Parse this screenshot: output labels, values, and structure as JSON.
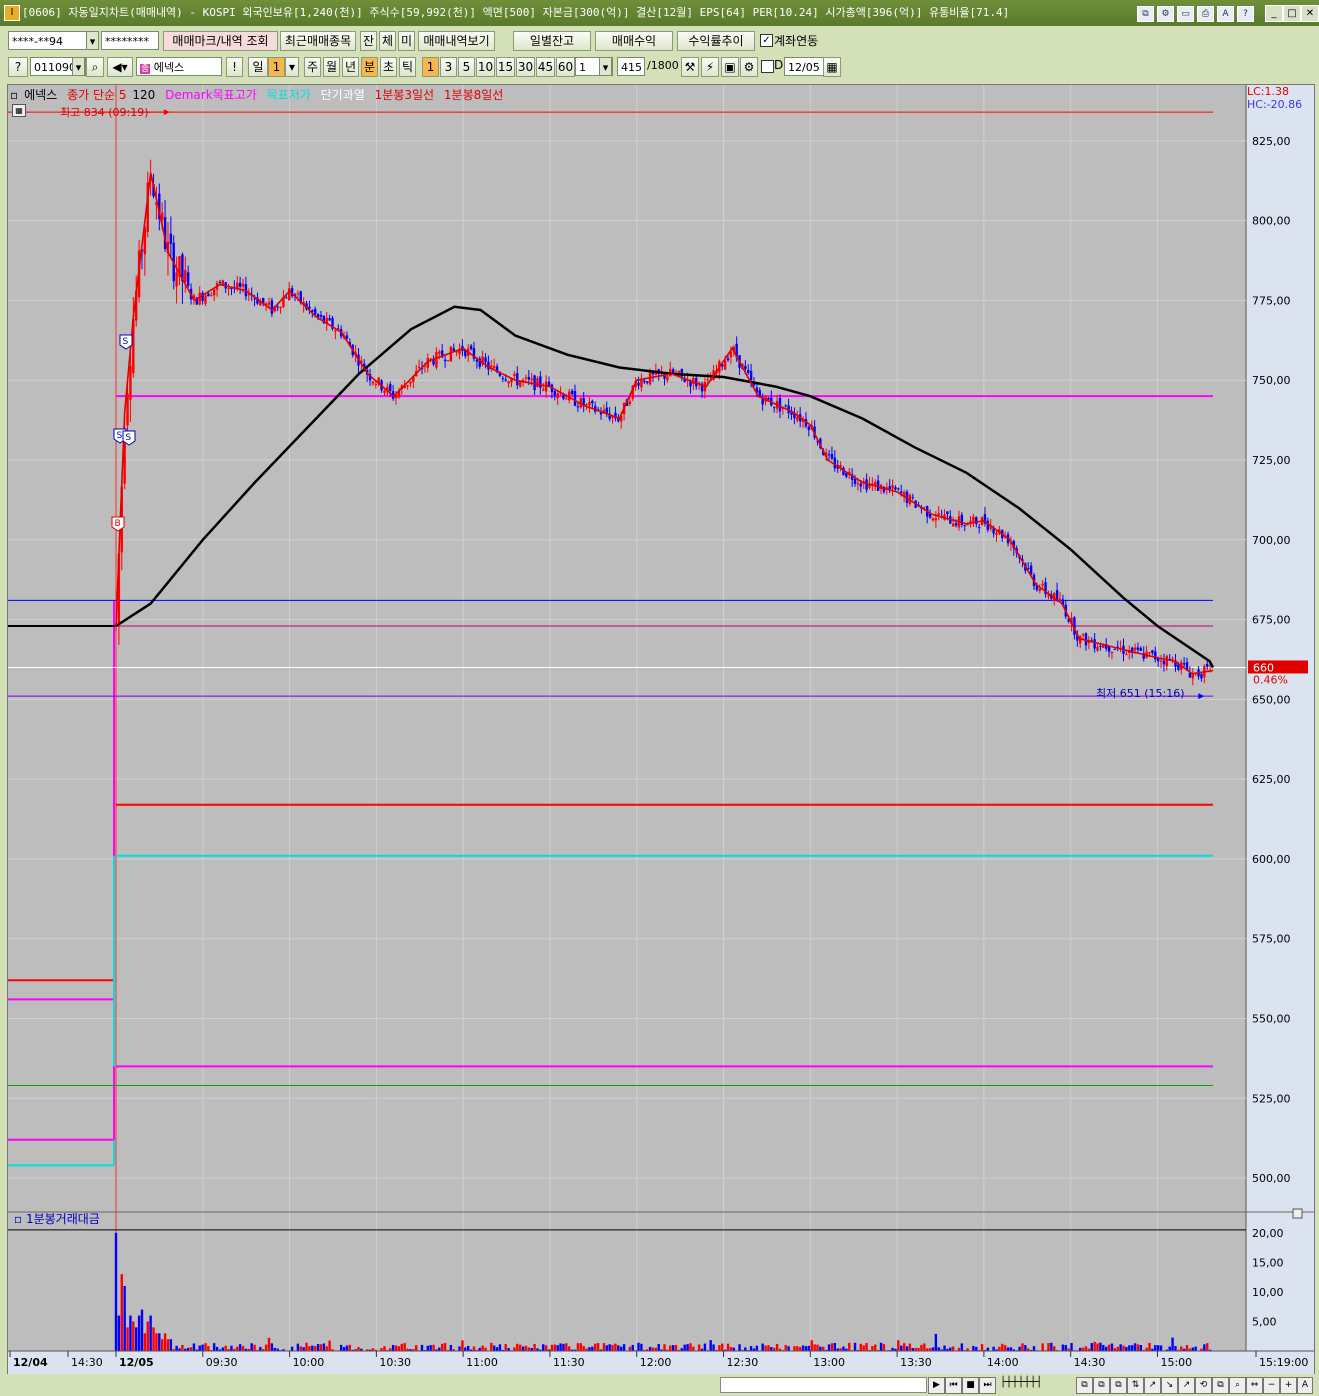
{
  "window": {
    "title": "[0606] 자동일지차트(매매내역) - KOSPI 외국인보유[1,240(천)] 주식수[59,992(천)] 액면[500] 자본금[300(억)] 결산[12월] EPS[64] PER[10.24] 시가총액[396(억)] 유통비율[71.4]",
    "icon": "app-icon"
  },
  "toolbar1": {
    "account": "****-**94",
    "password": "********",
    "btn_trade_mark": "매매마크/내역 조회",
    "btn_recent": "최근매매종목",
    "btn_jan": "잔",
    "btn_che": "체",
    "btn_mi": "미",
    "btn_history": "매매내역보기",
    "btn_daily_balance": "일별잔고",
    "btn_profit": "매매수익",
    "btn_return": "수익률추이",
    "account_link_label": "계좌연동",
    "account_link_checked": true
  },
  "toolbar2": {
    "code": "011090",
    "name": "에넥스",
    "period_day": "일",
    "period_day_value": "1",
    "periods": [
      "주",
      "월",
      "년",
      "분",
      "초",
      "틱"
    ],
    "active_period": "분",
    "intervals": [
      "1",
      "3",
      "5",
      "10",
      "15",
      "30",
      "45",
      "60"
    ],
    "active_interval": "1",
    "interval_input": "1",
    "count": "415",
    "count_max": "/1800",
    "date_check_label": "D",
    "date": "12/05"
  },
  "legend": {
    "stock": "에넥스",
    "ma": "종가 단순 5",
    "ma_long": "120",
    "demark_target": "Demark목표고가",
    "target_low": "목표저가",
    "short_overheat": "단기과열",
    "line3": "1분봉3일선",
    "line8": "1분봉8일선"
  },
  "corner": {
    "lc": "LC:1.38",
    "hc": "HC:-20.86"
  },
  "annotations": {
    "high": "최고 834 (09:19)",
    "low": "최저 651 (15:16)",
    "current_price": "660",
    "current_pct": "0.46%"
  },
  "volume_panel": {
    "title": "1분봉거래대금"
  },
  "colors": {
    "up": "#ff0000",
    "down": "#0000ff",
    "ma5": "#e00000",
    "ma120": "#000000",
    "demark": "#ff00ff",
    "target_low": "#00e0e0"
  },
  "chart_data": {
    "type": "candlestick",
    "ylim": [
      490,
      840
    ],
    "yticks": [
      "825,00",
      "800,00",
      "775,00",
      "750,00",
      "725,00",
      "700,00",
      "675,00",
      "650,00",
      "625,00",
      "600,00",
      "575,00",
      "550,00",
      "525,00",
      "500,00"
    ],
    "ytick_values": [
      825,
      800,
      775,
      750,
      725,
      700,
      675,
      650,
      625,
      600,
      575,
      550,
      525,
      500
    ],
    "xticks": [
      "12/04",
      "14:30",
      "12/05",
      "09:30",
      "10:00",
      "10:30",
      "11:00",
      "11:30",
      "12:00",
      "12:30",
      "13:00",
      "13:30",
      "14:00",
      "14:30",
      "15:00",
      "15:19:00"
    ],
    "high": 834,
    "low": 651,
    "current": 660,
    "ma5_close": [
      [
        9.0,
        673
      ],
      [
        9.02,
        700
      ],
      [
        9.05,
        740
      ],
      [
        9.1,
        770
      ],
      [
        9.2,
        815
      ],
      [
        9.3,
        790
      ],
      [
        9.45,
        775
      ],
      [
        9.6,
        780
      ],
      [
        9.75,
        778
      ],
      [
        9.9,
        772
      ],
      [
        10.0,
        778
      ],
      [
        10.15,
        770
      ],
      [
        10.3,
        765
      ],
      [
        10.45,
        752
      ],
      [
        10.6,
        745
      ],
      [
        10.8,
        756
      ],
      [
        11.0,
        760
      ],
      [
        11.15,
        754
      ],
      [
        11.3,
        750
      ],
      [
        11.5,
        748
      ],
      [
        11.7,
        742
      ],
      [
        11.9,
        738
      ],
      [
        12.0,
        750
      ],
      [
        12.2,
        752
      ],
      [
        12.4,
        748
      ],
      [
        12.55,
        760
      ],
      [
        12.7,
        745
      ],
      [
        12.9,
        740
      ],
      [
        13.0,
        736
      ],
      [
        13.1,
        725
      ],
      [
        13.3,
        718
      ],
      [
        13.5,
        715
      ],
      [
        13.7,
        708
      ],
      [
        13.9,
        705
      ],
      [
        14.0,
        706
      ],
      [
        14.15,
        700
      ],
      [
        14.3,
        686
      ],
      [
        14.45,
        680
      ],
      [
        14.55,
        669
      ],
      [
        14.7,
        667
      ],
      [
        14.85,
        665
      ],
      [
        15.0,
        663
      ],
      [
        15.1,
        662
      ],
      [
        15.2,
        658
      ],
      [
        15.32,
        659
      ]
    ],
    "ma120": [
      [
        9.0,
        673
      ],
      [
        9.2,
        680
      ],
      [
        9.5,
        700
      ],
      [
        9.8,
        718
      ],
      [
        10.1,
        735
      ],
      [
        10.4,
        752
      ],
      [
        10.7,
        766
      ],
      [
        10.95,
        773
      ],
      [
        11.1,
        772
      ],
      [
        11.3,
        764
      ],
      [
        11.6,
        758
      ],
      [
        11.9,
        754
      ],
      [
        12.2,
        752
      ],
      [
        12.5,
        751
      ],
      [
        12.8,
        748
      ],
      [
        13.0,
        745
      ],
      [
        13.3,
        738
      ],
      [
        13.6,
        729
      ],
      [
        13.9,
        721
      ],
      [
        14.2,
        710
      ],
      [
        14.5,
        697
      ],
      [
        14.8,
        682
      ],
      [
        15.0,
        673
      ],
      [
        15.3,
        662
      ],
      [
        15.32,
        660
      ]
    ],
    "levels": [
      {
        "name": "prev-close",
        "value": 673,
        "color": "#c8006e"
      },
      {
        "name": "blue-level",
        "value": 681,
        "color": "#0000ff"
      },
      {
        "name": "demark-high",
        "value": 745,
        "color": "#ff00ff"
      },
      {
        "name": "short-overheat",
        "value": 617,
        "color": "#ff0000"
      },
      {
        "name": "target-low",
        "value": 601,
        "color": "#00e0e0"
      },
      {
        "name": "demark-low",
        "value": 535,
        "color": "#ff00ff"
      },
      {
        "name": "green-level",
        "value": 529,
        "color": "#00aa00"
      },
      {
        "name": "high-line",
        "value": 834,
        "color": "#ff0000"
      },
      {
        "name": "low-line",
        "value": 651,
        "color": "#8000ff"
      }
    ],
    "prev_day_levels": [
      {
        "name": "prev-red",
        "value": 562,
        "color": "#ff0000"
      },
      {
        "name": "prev-pink",
        "value": 556,
        "color": "#ff00ff"
      },
      {
        "name": "prev-pink-low",
        "value": 512,
        "color": "#ff00ff"
      },
      {
        "name": "prev-cyan",
        "value": 504,
        "color": "#00e0e0"
      }
    ],
    "volume": {
      "ylim": [
        0,
        22
      ],
      "yticks": [
        "20,00",
        "15,00",
        "10,00",
        "5,00"
      ],
      "ytick_values": [
        20,
        15,
        10,
        5
      ],
      "bars_first_minutes": [
        20,
        6,
        13,
        11,
        4,
        6,
        5,
        4,
        6,
        7,
        3,
        5,
        6,
        4,
        3,
        3,
        2,
        3,
        2,
        2
      ]
    }
  }
}
